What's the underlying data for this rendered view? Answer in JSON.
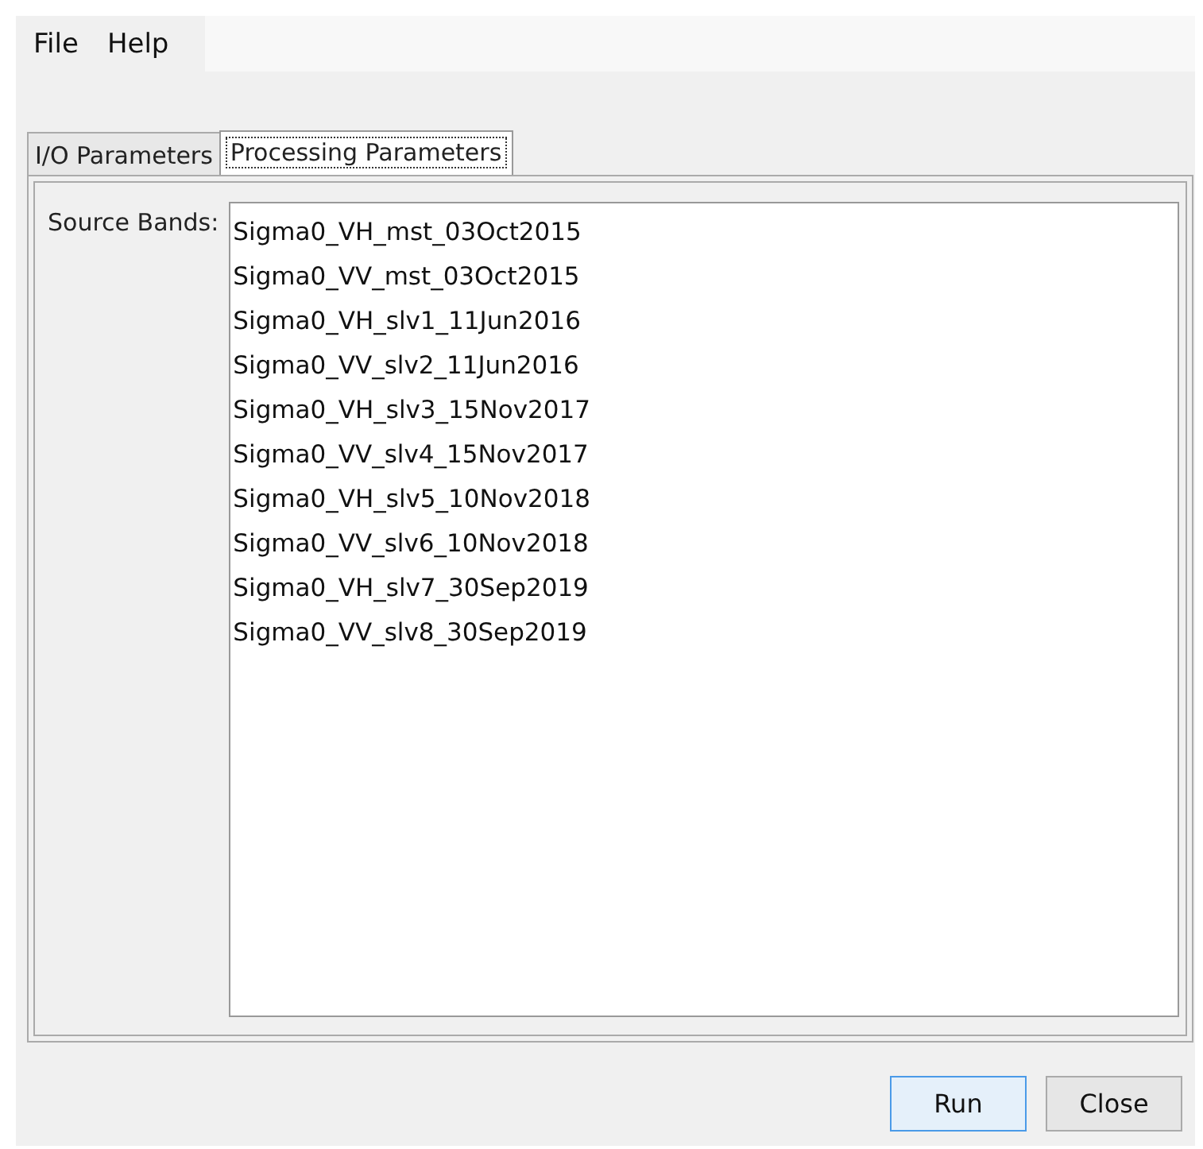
{
  "menu": [
    "File",
    "Help"
  ],
  "tabs": [
    {
      "label": "I/O Parameters",
      "selected": false
    },
    {
      "label": "Processing Parameters",
      "selected": true
    }
  ],
  "source_bands": {
    "label": "Source Bands:",
    "items": [
      "Sigma0_VH_mst_03Oct2015",
      "Sigma0_VV_mst_03Oct2015",
      "Sigma0_VH_slv1_11Jun2016",
      "Sigma0_VV_slv2_11Jun2016",
      "Sigma0_VH_slv3_15Nov2017",
      "Sigma0_VV_slv4_15Nov2017",
      "Sigma0_VH_slv5_10Nov2018",
      "Sigma0_VV_slv6_10Nov2018",
      "Sigma0_VH_slv7_30Sep2019",
      "Sigma0_VV_slv8_30Sep2019"
    ]
  },
  "buttons": [
    {
      "label": "Run",
      "selected": true
    },
    {
      "label": "Close",
      "selected": false
    }
  ]
}
